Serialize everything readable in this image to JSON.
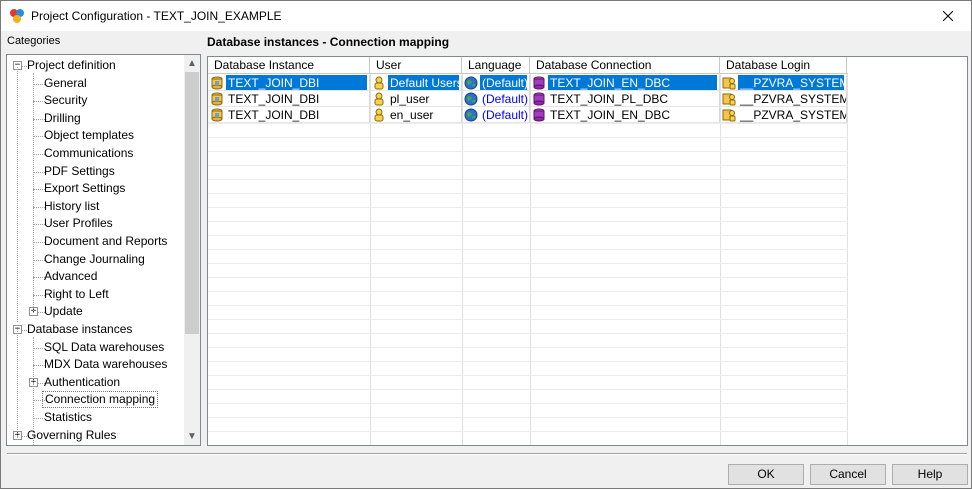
{
  "window": {
    "title": "Project Configuration - TEXT_JOIN_EXAMPLE"
  },
  "categories": {
    "label": "Categories",
    "tree": [
      {
        "label": "Project definition",
        "level": 0,
        "expander": "−"
      },
      {
        "label": "General",
        "level": 1
      },
      {
        "label": "Security",
        "level": 1
      },
      {
        "label": "Drilling",
        "level": 1
      },
      {
        "label": "Object templates",
        "level": 1
      },
      {
        "label": "Communications",
        "level": 1
      },
      {
        "label": "PDF Settings",
        "level": 1
      },
      {
        "label": "Export Settings",
        "level": 1
      },
      {
        "label": "History list",
        "level": 1
      },
      {
        "label": "User Profiles",
        "level": 1
      },
      {
        "label": "Document and Reports",
        "level": 1
      },
      {
        "label": "Change Journaling",
        "level": 1
      },
      {
        "label": "Advanced",
        "level": 1
      },
      {
        "label": "Right to Left",
        "level": 1
      },
      {
        "label": "Update",
        "level": 1,
        "expander": "+"
      },
      {
        "label": "Database instances",
        "level": 0,
        "expander": "−"
      },
      {
        "label": "SQL Data warehouses",
        "level": 1
      },
      {
        "label": "MDX Data warehouses",
        "level": 1
      },
      {
        "label": "Authentication",
        "level": 1,
        "expander": "+"
      },
      {
        "label": "Connection mapping",
        "level": 1,
        "selected": true
      },
      {
        "label": "Statistics",
        "level": 1
      },
      {
        "label": "Governing Rules",
        "level": 0,
        "expander": "+"
      }
    ]
  },
  "section": {
    "title": "Database instances - Connection mapping"
  },
  "grid": {
    "columns": [
      "Database Instance",
      "User",
      "Language",
      "Database Connection",
      "Database Login"
    ],
    "rows": [
      {
        "instance": "TEXT_JOIN_DBI",
        "user": "Default Users",
        "language": "(Default)",
        "connection": "TEXT_JOIN_EN_DBC",
        "login": "__PZVRA_SYSTEM",
        "selected": true
      },
      {
        "instance": "TEXT_JOIN_DBI",
        "user": "pl_user",
        "language": "(Default)",
        "connection": "TEXT_JOIN_PL_DBC",
        "login": "__PZVRA_SYSTEM",
        "selected": false
      },
      {
        "instance": "TEXT_JOIN_DBI",
        "user": "en_user",
        "language": "(Default)",
        "connection": "TEXT_JOIN_EN_DBC",
        "login": "__PZVRA_SYSTEM",
        "selected": false
      }
    ]
  },
  "buttons": {
    "ok": "OK",
    "cancel": "Cancel",
    "help": "Help"
  },
  "colors": {
    "selection": "#0078d7",
    "default_language": "#0000ff"
  }
}
